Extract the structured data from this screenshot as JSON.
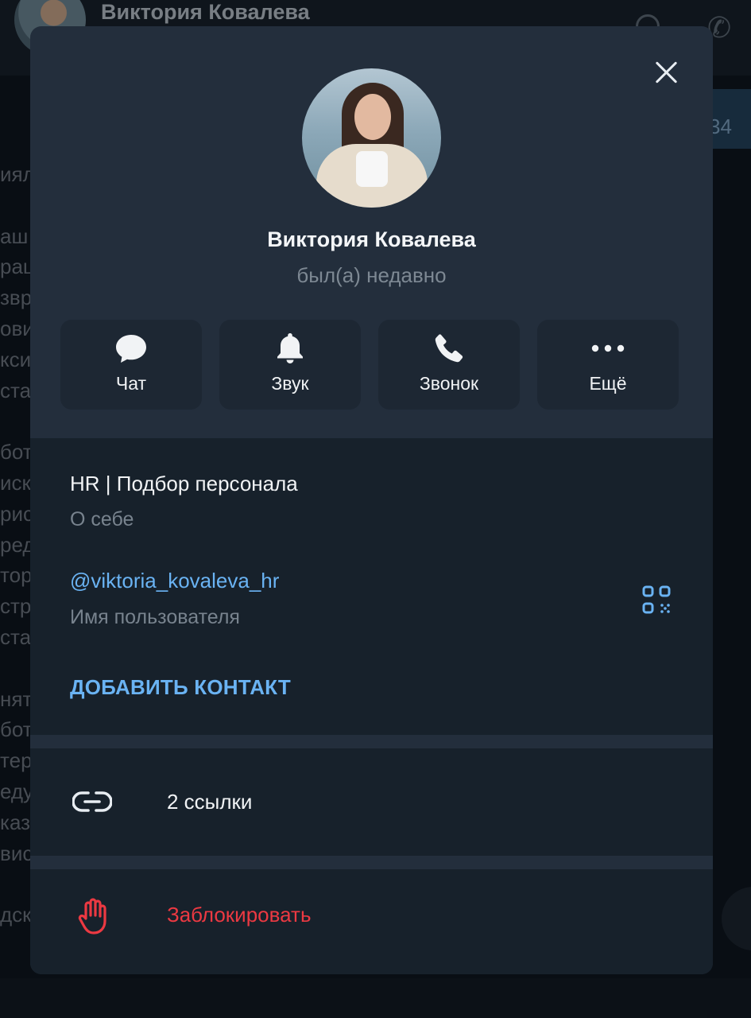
{
  "background": {
    "chat_title": "Виктория Ковалева",
    "chip_text": "34",
    "text_fragments": [
      "иял",
      "",
      "аш",
      "раш",
      "звр",
      "ови",
      "кси",
      "стан",
      "",
      "бот",
      "иск",
      "рис",
      "ред",
      "тор",
      "стр",
      "стан",
      "",
      "нят",
      "бот",
      "тер",
      "еду",
      "каз",
      "вис",
      "",
      "дск"
    ]
  },
  "profile": {
    "name": "Виктория Ковалева",
    "status": "был(а) недавно"
  },
  "actions": [
    {
      "label": "Чат",
      "icon": "chat-bubble-icon"
    },
    {
      "label": "Звук",
      "icon": "bell-icon"
    },
    {
      "label": "Звонок",
      "icon": "phone-icon"
    },
    {
      "label": "Ещё",
      "icon": "more-dots-icon"
    }
  ],
  "info": {
    "bio": "HR | Подбор персонала",
    "bio_caption": "О себе",
    "username": "@viktoria_kovaleva_hr",
    "username_caption": "Имя пользователя",
    "add_contact": "ДОБАВИТЬ КОНТАКТ"
  },
  "links": {
    "label": "2 ссылки",
    "icon": "link-icon"
  },
  "block": {
    "label": "Заблокировать",
    "icon": "hand-stop-icon"
  },
  "colors": {
    "modal_bg": "#232e3c",
    "section_bg": "#17212b",
    "accent": "#6ab3f3",
    "danger": "#ec3942"
  }
}
